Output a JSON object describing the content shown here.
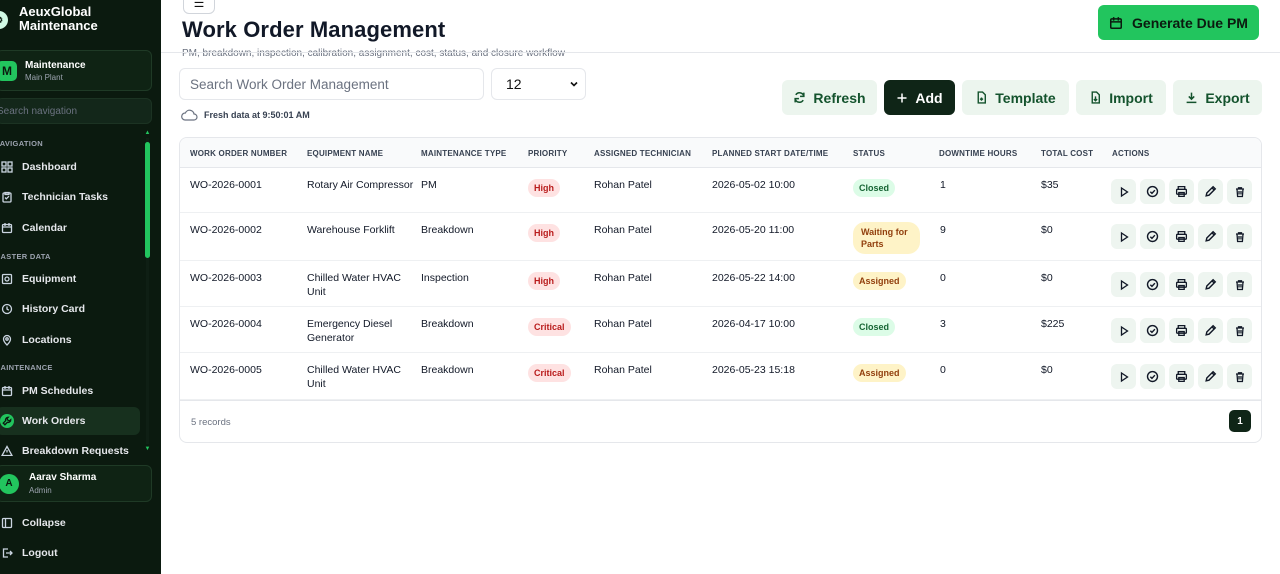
{
  "app": {
    "name": "AeuxGlobal Maintenance",
    "logo_glyph": "⚙"
  },
  "sidebar": {
    "module": {
      "badge": "M",
      "title": "Maintenance",
      "subtitle": "Main Plant"
    },
    "search_placeholder": "Search navigation",
    "sections": {
      "navigation": "NAVIGATION",
      "master_data": "MASTER DATA",
      "maintenance": "MAINTENANCE"
    },
    "items": [
      {
        "label": "Dashboard",
        "icon": "dashboard-icon"
      },
      {
        "label": "Technician Tasks",
        "icon": "clipboard-icon"
      },
      {
        "label": "Calendar",
        "icon": "calendar-icon"
      },
      {
        "label": "Equipment",
        "icon": "equipment-icon"
      },
      {
        "label": "History Card",
        "icon": "history-icon"
      },
      {
        "label": "Locations",
        "icon": "location-pin-icon"
      },
      {
        "label": "PM Schedules",
        "icon": "calendar-icon"
      },
      {
        "label": "Work Orders",
        "icon": "wrench-icon",
        "active": true
      },
      {
        "label": "Breakdown Requests",
        "icon": "alert-icon"
      }
    ],
    "user": {
      "initial": "A",
      "name": "Aarav Sharma",
      "role": "Admin"
    },
    "collapse_label": "Collapse",
    "logout_label": "Logout"
  },
  "header": {
    "menu_glyph": "☰",
    "title": "Work Order Management",
    "subtitle": "PM, breakdown, inspection, calibration, assignment, cost, status, and closure workflow",
    "generate_button": "Generate Due PM"
  },
  "toolbar": {
    "search_placeholder": "Search Work Order Management",
    "page_size": "12",
    "fresh_text": "Fresh data at 9:50:01 AM",
    "refresh": "Refresh",
    "add": "Add",
    "template": "Template",
    "import": "Import",
    "export": "Export"
  },
  "table": {
    "columns": [
      "WORK ORDER NUMBER",
      "EQUIPMENT NAME",
      "MAINTENANCE TYPE",
      "PRIORITY",
      "ASSIGNED TECHNICIAN",
      "PLANNED START DATE/TIME",
      "STATUS",
      "DOWNTIME HOURS",
      "TOTAL COST",
      "ACTIONS"
    ],
    "rows": [
      {
        "wo": "WO-2026-0001",
        "equipment": "Rotary Air Compressor",
        "type": "PM",
        "priority": "High",
        "technician": "Rohan Patel",
        "start": "2026-05-02 10:00",
        "status": "Closed",
        "downtime": "1",
        "cost": "$35"
      },
      {
        "wo": "WO-2026-0002",
        "equipment": "Warehouse Forklift",
        "type": "Breakdown",
        "priority": "High",
        "technician": "Rohan Patel",
        "start": "2026-05-20 11:00",
        "status": "Waiting for Parts",
        "downtime": "9",
        "cost": "$0"
      },
      {
        "wo": "WO-2026-0003",
        "equipment": "Chilled Water HVAC Unit",
        "type": "Inspection",
        "priority": "High",
        "technician": "Rohan Patel",
        "start": "2026-05-22 14:00",
        "status": "Assigned",
        "downtime": "0",
        "cost": "$0"
      },
      {
        "wo": "WO-2026-0004",
        "equipment": "Emergency Diesel Generator",
        "type": "Breakdown",
        "priority": "Critical",
        "technician": "Rohan Patel",
        "start": "2026-04-17 10:00",
        "status": "Closed",
        "downtime": "3",
        "cost": "$225"
      },
      {
        "wo": "WO-2026-0005",
        "equipment": "Chilled Water HVAC Unit",
        "type": "Breakdown",
        "priority": "Critical",
        "technician": "Rohan Patel",
        "start": "2026-05-23 15:18",
        "status": "Assigned",
        "downtime": "0",
        "cost": "$0"
      }
    ],
    "actions": [
      "play-icon",
      "check-circle-icon",
      "print-icon",
      "edit-icon",
      "delete-icon"
    ],
    "records_text": "5 records",
    "current_page": "1"
  },
  "colors": {
    "sidebar_bg": "#0b1a0f",
    "accent": "#22c55e",
    "dark_button": "#0f2517",
    "light_button": "#ecf5ee"
  }
}
